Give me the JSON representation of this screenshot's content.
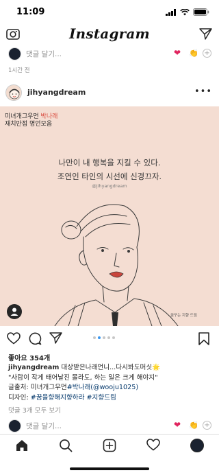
{
  "status": {
    "time": "11:09"
  },
  "header": {
    "logo": "Instagram",
    "icons": [
      "camera-icon",
      "direct-icon"
    ]
  },
  "top_comment": {
    "placeholder": "댓글 달기...",
    "reactions": [
      "heart",
      "clap"
    ]
  },
  "timestamp": "1시간 전",
  "post": {
    "username": "jihyangdream",
    "image": {
      "caption_line1_prefix": "미녀개그우먼 ",
      "caption_line1_highlight": "박나래",
      "caption_line2": "재치만점 명언모음",
      "quote_line1": "나만이 내 행복을 지킬 수 있다.",
      "quote_line2": "조연인 타인의 시선에 신경끄자.",
      "handle": "@jihyangdream",
      "signature": "꿈꾸는 지향 드림"
    },
    "carousel": {
      "count": 5,
      "active": 1
    },
    "likes": "좋아요 354개",
    "caption": {
      "user": "jihyangdream",
      "line1": " 대상받은나래언니...다시봐도머싯🌟",
      "line2": "\"사람이 작게 태어날진 몰라도, 하는 일은 크게 해야지\"",
      "line3_prefix": "글출처: 미녀개그우먼",
      "line3_hashtag": "#박나래",
      "line3_suffix": "(@wooju1025)",
      "line4_prefix": "디자인:",
      "line4_hashtag1": "#꿈을향해지향하라",
      "line4_hashtag2": "#지향드림"
    },
    "view_comments": "댓글 3개 모두 보기"
  },
  "bottom_comment": {
    "placeholder": "댓글 달기...",
    "reactions": [
      "heart",
      "clap"
    ]
  },
  "nav": {
    "items": [
      "home-icon",
      "search-icon",
      "new-post-icon",
      "activity-icon",
      "profile-icon"
    ]
  },
  "colors": {
    "accent": "#3897f0",
    "heart": "#e0245e",
    "hashtag": "#003569",
    "image_bg": "#f4ddd2"
  }
}
